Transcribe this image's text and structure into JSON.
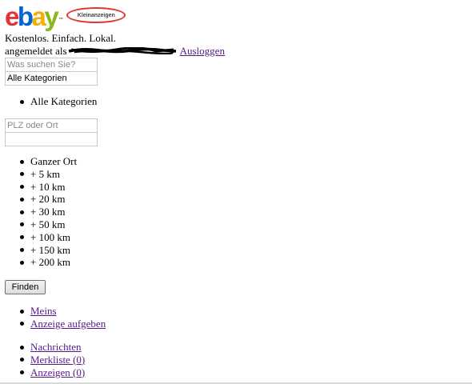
{
  "header": {
    "logo_text": "ebay",
    "logo_letters": [
      {
        "char": "e",
        "color": "#e53238"
      },
      {
        "char": "b",
        "color": "#0064d2"
      },
      {
        "char": "a",
        "color": "#f5af02"
      },
      {
        "char": "y",
        "color": "#86b817"
      }
    ],
    "trademark": "™",
    "badge": "Kleinanzeigen",
    "tagline": "Kostenlos. Einfach. Lokal.",
    "logged_in_label": "angemeldet als",
    "logout_link": "Ausloggen"
  },
  "search": {
    "query_placeholder": "Was suchen Sie?",
    "category_value": "Alle Kategorien",
    "category_options": [
      "Alle Kategorien"
    ],
    "location_placeholder": "PLZ oder Ort",
    "location_value": ""
  },
  "radius": {
    "options": [
      "Ganzer Ort",
      "+ 5 km",
      "+ 10 km",
      "+ 20 km",
      "+ 30 km",
      "+ 50 km",
      "+ 100 km",
      "+ 150 km",
      "+ 200 km"
    ]
  },
  "find_button": "Finden",
  "nav_primary": [
    "Meins",
    "Anzeige aufgeben"
  ],
  "nav_secondary": [
    "Nachrichten",
    "Merkliste (0)",
    "Anzeigen (0)"
  ],
  "colors": {
    "link": "#551a8b",
    "badge_border": "#e53238",
    "redaction": "#000000"
  }
}
